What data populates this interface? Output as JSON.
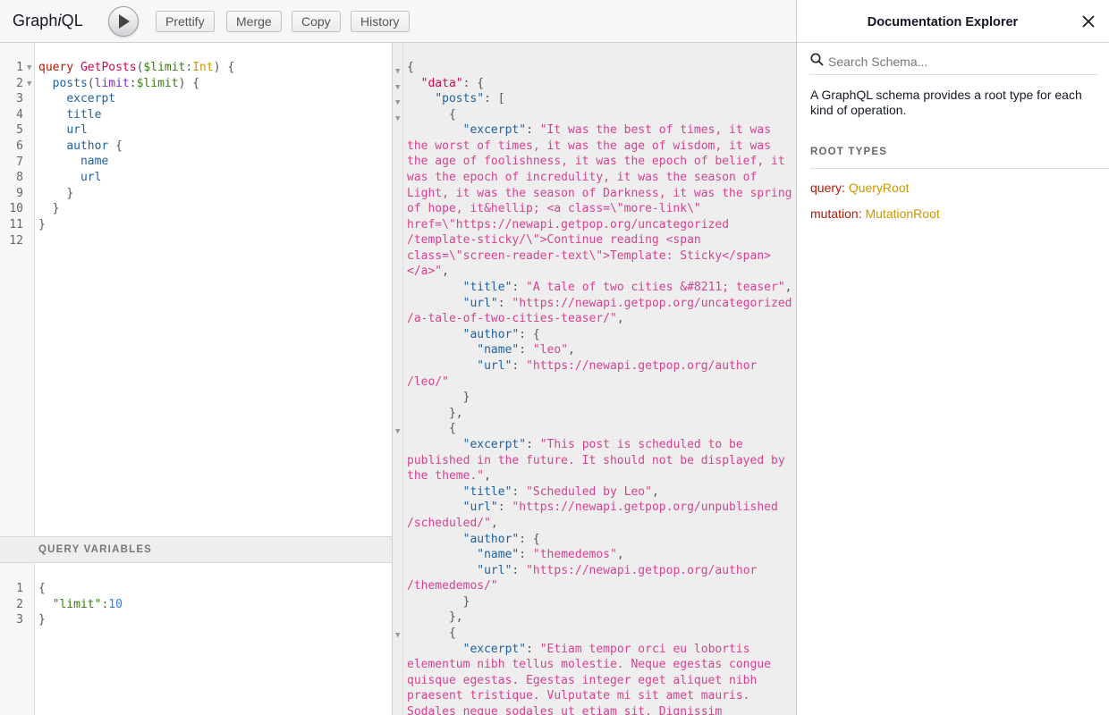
{
  "app": {
    "logo_prefix": "Graph",
    "logo_i": "i",
    "logo_suffix": "QL"
  },
  "toolbar": {
    "execute_label": "Execute query",
    "prettify": "Prettify",
    "merge": "Merge",
    "copy": "Copy",
    "history": "History"
  },
  "query_editor": {
    "line_numbers": [
      "1",
      "2",
      "3",
      "4",
      "5",
      "6",
      "7",
      "8",
      "9",
      "10",
      "11",
      "12"
    ]
  },
  "variables": {
    "header": "QUERY VARIABLES",
    "line_numbers": [
      "1",
      "2",
      "3"
    ]
  },
  "docs": {
    "title": "Documentation Explorer",
    "search_placeholder": "Search Schema...",
    "description": "A GraphQL schema provides a root type for each kind of operation.",
    "root_types_header": "ROOT TYPES",
    "query_key": "query",
    "query_type": "QueryRoot",
    "mutation_key": "mutation",
    "mutation_type": "MutationRoot"
  },
  "colors": {
    "keyword": "#b11a04",
    "def": "#d2054e",
    "variable": "#397d13",
    "type": "#ca9800",
    "field": "#1f61a0",
    "string": "#d64292",
    "number": "#2882f9"
  }
}
